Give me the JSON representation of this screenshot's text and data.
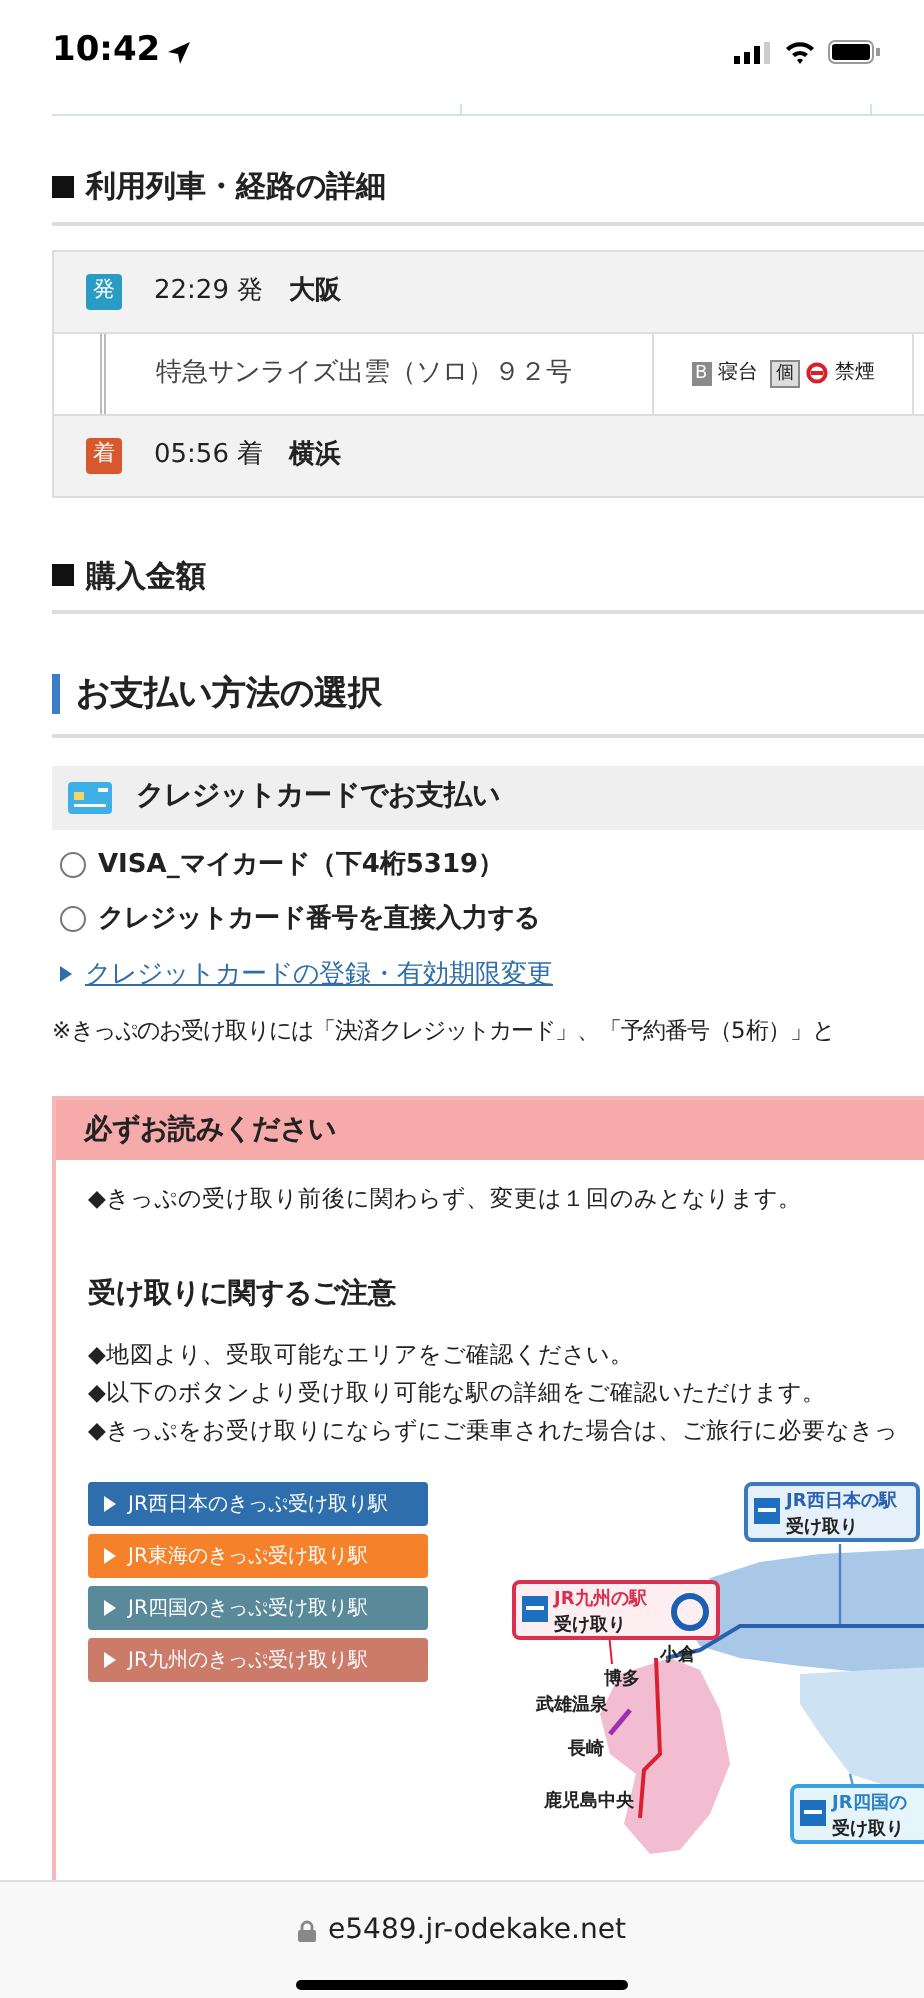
{
  "status_bar": {
    "time": "10:42"
  },
  "route_section": {
    "title": "利用列車・経路の詳細",
    "departure": {
      "badge": "発",
      "time": "22:29 発",
      "station": "大阪"
    },
    "train": {
      "name": "特急サンライズ出雲（ソロ）９２号",
      "facilities": [
        {
          "mark": "B",
          "label": "寝台",
          "no_smoking": false
        },
        {
          "mark": "個",
          "label": "禁煙",
          "no_smoking": true
        }
      ]
    },
    "arrival": {
      "badge": "着",
      "time": "05:56 着",
      "station": "横浜"
    }
  },
  "purchase_section": {
    "title": "購入金額"
  },
  "payment": {
    "title": "お支払い方法の選択",
    "method": "クレジットカードでお支払い",
    "options": [
      {
        "label": "VISA_マイカード（下4桁5319）",
        "selected": false
      },
      {
        "label": "クレジットカード番号を直接入力する",
        "selected": false
      }
    ],
    "link": "クレジットカードの登録・有効期限変更",
    "note": "※きっぷのお受け取りには「決済クレジットカード」、「予約番号（5桁）」と"
  },
  "notice": {
    "title": "必ずお読みください",
    "message": "◆きっぷの受け取り前後に関わらず、変更は１回のみとなります。",
    "subtitle": "受け取りに関するご注意",
    "bullets": [
      "◆地図より、受取可能なエリアをご確認ください。",
      "◆以下のボタンより受け取り可能な駅の詳細をご確認いただけます。",
      "◆きっぷをお受け取りにならずにご乗車された場合は、ご旅行に必要なきっ"
    ],
    "buttons": [
      {
        "label": "JR西日本のきっぷ受け取り駅",
        "color": "#2e6eac"
      },
      {
        "label": "JR東海のきっぷ受け取り駅",
        "color": "#f5822b"
      },
      {
        "label": "JR四国のきっぷ受け取り駅",
        "color": "#5a8a99"
      },
      {
        "label": "JR九州のきっぷ受け取り駅",
        "color": "#cc7a6a"
      }
    ],
    "map": {
      "west_box": [
        "JR西日本の駅",
        "受け取り"
      ],
      "kyushu_box": [
        "JR九州の駅",
        "受け取り"
      ],
      "shikoku_box": [
        "JR四国の",
        "受け取り"
      ],
      "stations": [
        "小倉",
        "博多",
        "武雄温泉",
        "長崎",
        "鹿児島中央"
      ]
    }
  },
  "browser": {
    "url": "e5489.jr-odekake.net"
  }
}
